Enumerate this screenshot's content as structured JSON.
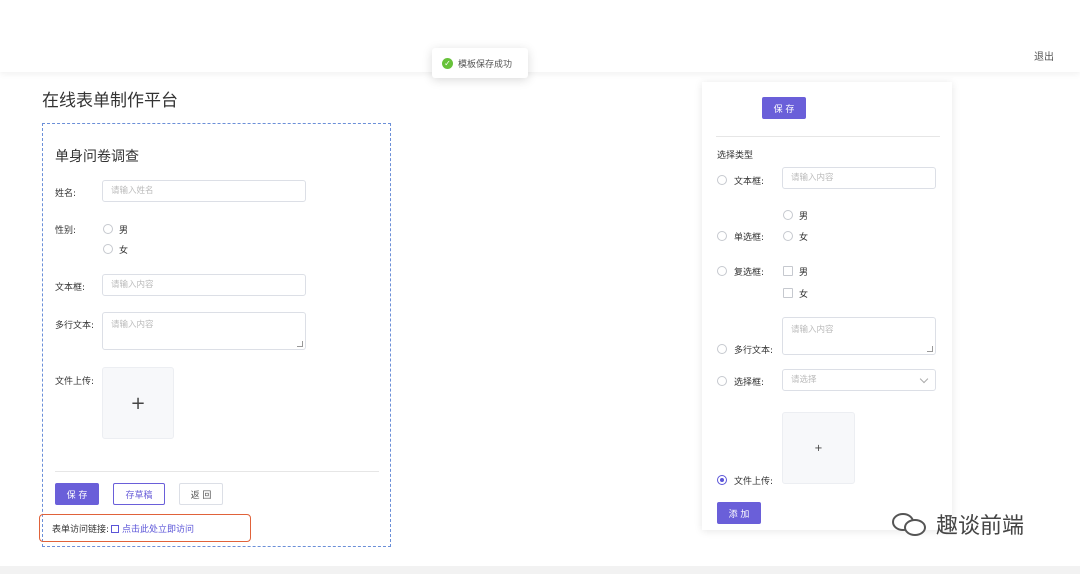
{
  "header": {
    "logout": "退出"
  },
  "toast": {
    "message": "模板保存成功",
    "icon": "check-circle-icon"
  },
  "page": {
    "title": "在线表单制作平台"
  },
  "form": {
    "title": "单身问卷调查",
    "name_label": "姓名:",
    "name_placeholder": "请输入姓名",
    "gender_label": "性别:",
    "gender_options": [
      "男",
      "女"
    ],
    "text_label": "文本框:",
    "text_placeholder": "请输入内容",
    "multiline_label": "多行文本:",
    "multiline_placeholder": "请输入内容",
    "upload_label": "文件上传:",
    "upload_plus": "+",
    "buttons": {
      "save": "保 存",
      "draft": "存草稿",
      "back": "返 回"
    },
    "link_label": "表单访问链接:",
    "link_text": "点击此处立即访问"
  },
  "panel": {
    "save": "保 存",
    "section_title": "选择类型",
    "text_label": "文本框:",
    "text_placeholder": "请输入内容",
    "radio_label": "单选框:",
    "radio_options": [
      "男",
      "女"
    ],
    "checkbox_label": "复选框:",
    "checkbox_options": [
      "男",
      "女"
    ],
    "multiline_label": "多行文本:",
    "multiline_placeholder": "请输入内容",
    "select_label": "选择框:",
    "select_placeholder": "请选择",
    "upload_label": "文件上传:",
    "upload_plus": "+",
    "selected_type": "文件上传",
    "add": "添 加"
  },
  "watermark": {
    "text": "趣谈前端"
  },
  "colors": {
    "primary": "#6a5fd9",
    "success": "#67c23a",
    "highlight": "#e0623a",
    "dashed_border": "#6b8fd8"
  }
}
